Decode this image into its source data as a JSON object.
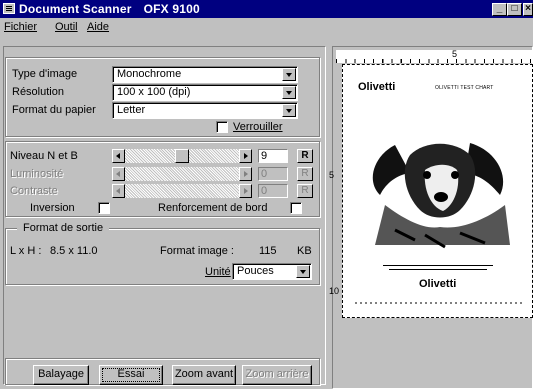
{
  "window": {
    "title": "Document Scanner",
    "model": "OFX 9100",
    "minimize_glyph": "_",
    "maximize_glyph": "□",
    "close_glyph": "×"
  },
  "menu": [
    {
      "label": "Fichier"
    },
    {
      "label": "Outil"
    },
    {
      "label": "Aide"
    }
  ],
  "settings": {
    "image_type_label": "Type d'image",
    "image_type_value": "Monochrome",
    "resolution_label": "Résolution",
    "resolution_value": "100 x 100 (dpi)",
    "paper_label": "Format du papier",
    "paper_value": "Letter",
    "lock_label": "Verrouiller",
    "lock_checked": false
  },
  "adjust": {
    "bw_label": "Niveau N et B",
    "bw_value": "9",
    "bw_level": 0.5,
    "brightness_label": "Luminosité",
    "brightness_value": "0",
    "contrast_label": "Contraste",
    "contrast_value": "0",
    "reset_label": "R",
    "invert_label": "Inversion",
    "edge_label": "Renforcement de bord"
  },
  "output": {
    "group_label": "Format de sortie",
    "size_label": "L x H :",
    "size_value": "8.5 x 11.0",
    "image_size_label": "Format image :",
    "image_size_value": "115",
    "image_size_unit": "KB",
    "unit_label": "Unité",
    "unit_value": "Pouces"
  },
  "buttons": {
    "scan": "Balayage",
    "test": "Essai",
    "zoom_in": "Zoom avant",
    "zoom_out": "Zoom arrière"
  },
  "preview": {
    "ruler_marks": [
      "5",
      "5",
      "10"
    ],
    "doc_brand": "Olivetti",
    "doc_sub": "OLIVETTI TEST CHART",
    "doc_brand_bottom": "Olivetti"
  },
  "colors": {
    "titlebar": "#000080",
    "face": "#c0c0c0",
    "shadow": "#808080"
  }
}
